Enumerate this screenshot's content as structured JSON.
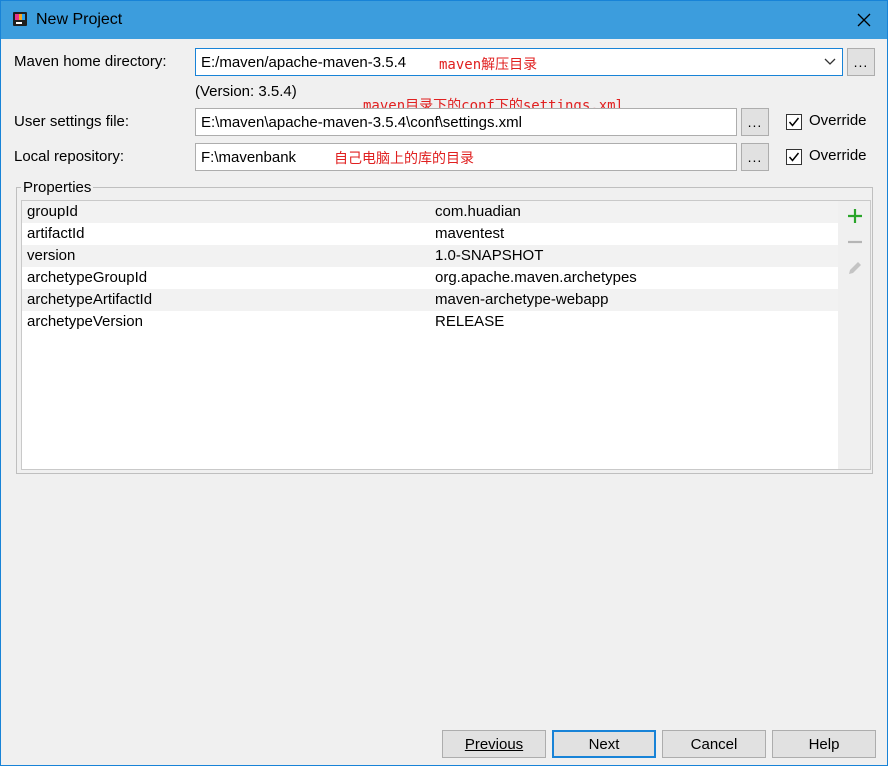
{
  "window": {
    "title": "New Project"
  },
  "maven_home": {
    "label": "Maven home directory:",
    "value": "E:/maven/apache-maven-3.5.4",
    "annotation": "maven解压目录",
    "version": "(Version: 3.5.4)"
  },
  "annotation_settings": "maven目录下的conf下的settings.xml",
  "user_settings": {
    "label": "User settings file:",
    "value": "E:\\maven\\apache-maven-3.5.4\\conf\\settings.xml",
    "override_label": "Override",
    "override_checked": true
  },
  "local_repo": {
    "label": "Local repository:",
    "value": "F:\\mavenbank",
    "annotation": "自己电脑上的库的目录",
    "override_label": "Override",
    "override_checked": true
  },
  "browse_label": "...",
  "properties": {
    "title": "Properties",
    "rows": [
      {
        "key": "groupId",
        "value": "com.huadian"
      },
      {
        "key": "artifactId",
        "value": "maventest"
      },
      {
        "key": "version",
        "value": "1.0-SNAPSHOT"
      },
      {
        "key": "archetypeGroupId",
        "value": "org.apache.maven.archetypes"
      },
      {
        "key": "archetypeArtifactId",
        "value": "maven-archetype-webapp"
      },
      {
        "key": "archetypeVersion",
        "value": "RELEASE"
      }
    ]
  },
  "buttons": {
    "previous": "Previous",
    "next": "Next",
    "cancel": "Cancel",
    "help": "Help"
  },
  "colors": {
    "titlebar": "#3c9ddd",
    "accent": "#1883d7",
    "annotation": "#e02020",
    "add_icon": "#2aa52a"
  }
}
